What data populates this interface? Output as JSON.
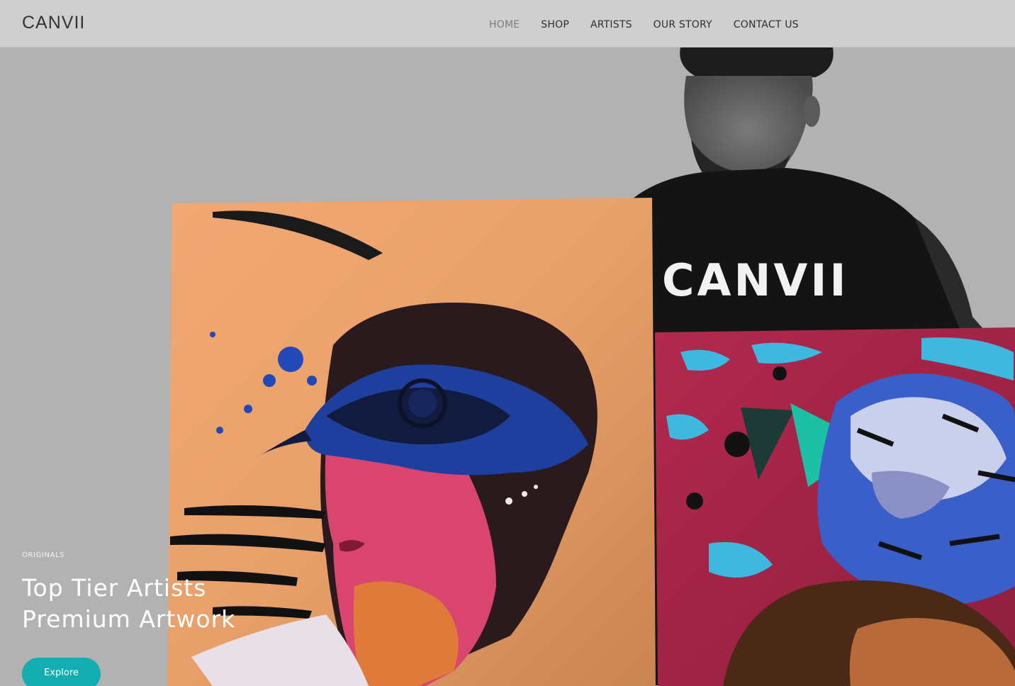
{
  "brand": {
    "logo_text": "CANVII"
  },
  "nav": {
    "items": [
      {
        "label": "HOME",
        "active": true
      },
      {
        "label": "SHOP",
        "active": false
      },
      {
        "label": "ARTISTS",
        "active": false
      },
      {
        "label": "OUR STORY",
        "active": false
      },
      {
        "label": "CONTACT US",
        "active": false
      }
    ]
  },
  "hero": {
    "eyebrow": "ORIGINALS",
    "headline_line1": "Top Tier Artists",
    "headline_line2": "Premium Artwork",
    "cta_label": "Explore",
    "shirt_text": "CANVII",
    "image_description": "Artist in black CANVII t-shirt holding two colorful paintings"
  },
  "colors": {
    "header_bg": "#cfcfcf",
    "hero_bg": "#b2b2b2",
    "accent": "#13aeb2",
    "nav_text": "#2e2e2e",
    "nav_active": "#7d7d7d"
  }
}
